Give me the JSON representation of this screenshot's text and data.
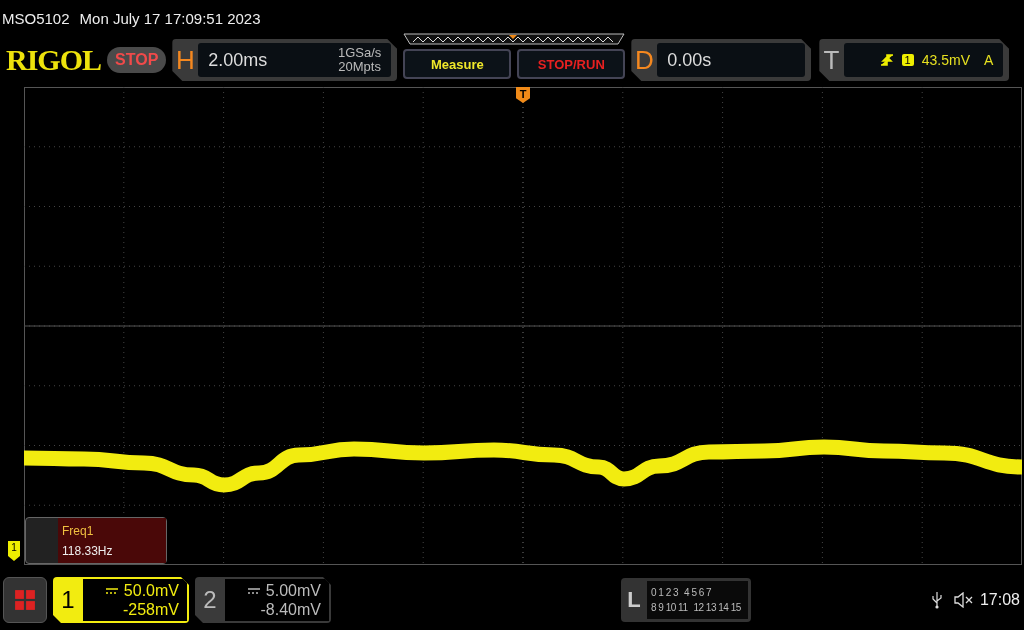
{
  "header": {
    "model": "MSO5102",
    "datetime": "Mon July 17 17:09:51 2023"
  },
  "logo": "RIGOL",
  "run_state": {
    "label": "STOP",
    "kind": "stop"
  },
  "horizontal": {
    "key": "H",
    "timebase": "2.00ms",
    "sample_rate": "1GSa/s",
    "memory_depth": "20Mpts"
  },
  "buttons": [
    {
      "label": "Measure",
      "kind": "measure"
    },
    {
      "label": "STOP/RUN",
      "kind": "run"
    }
  ],
  "delay": {
    "key": "D",
    "value": "0.00s"
  },
  "trigger": {
    "key": "T",
    "source": "1",
    "level": "43.5mV",
    "mode": "A"
  },
  "trigger_marker": "T",
  "channel_marker": "1",
  "measurement": {
    "name": "Freq1",
    "value": "118.33Hz"
  },
  "channels": [
    {
      "number": "1",
      "active": true,
      "scale": "50.0mV",
      "offset": "-258mV"
    },
    {
      "number": "2",
      "active": false,
      "scale": "5.00mV",
      "offset": "-8.40mV"
    }
  ],
  "logic": {
    "key": "L",
    "rows": [
      [
        "0 1 2 3",
        "4 5 6 7"
      ],
      [
        "8 9 10 11",
        "12 13 14 15"
      ]
    ]
  },
  "status": {
    "time": "17:08"
  }
}
